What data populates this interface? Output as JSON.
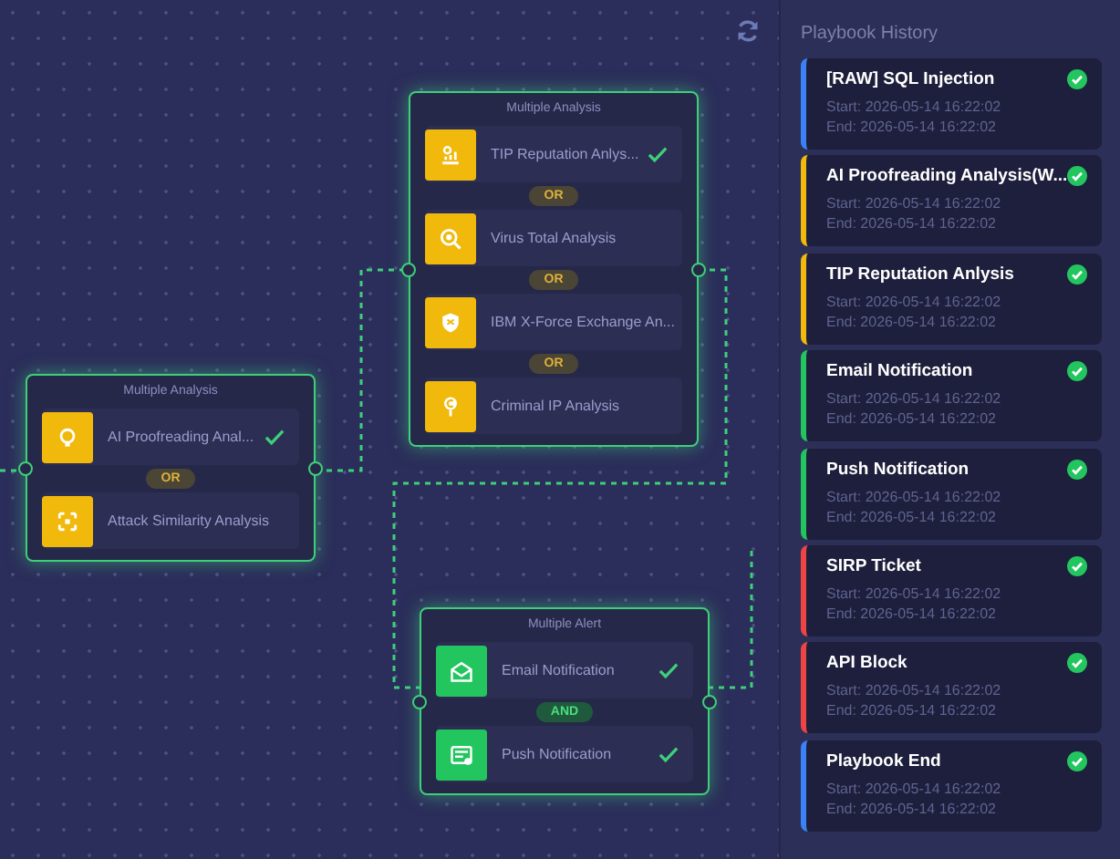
{
  "canvas": {
    "nodes": [
      {
        "title": "Multiple Analysis",
        "connectors": [
          "OR"
        ],
        "items": [
          {
            "label": "AI Proofreading Anal...",
            "done": true,
            "color": "#f0b90b"
          },
          {
            "label": "Attack Similarity Analysis",
            "done": false,
            "color": "#f0b90b"
          }
        ]
      },
      {
        "title": "Multiple Analysis",
        "connectors": [
          "OR",
          "OR",
          "OR"
        ],
        "items": [
          {
            "label": "TIP Reputation Anlys...",
            "done": true,
            "color": "#f0b90b"
          },
          {
            "label": "Virus Total Analysis",
            "done": false,
            "color": "#f0b90b"
          },
          {
            "label": "IBM X-Force Exchange An...",
            "done": false,
            "color": "#f0b90b"
          },
          {
            "label": "Criminal IP Analysis",
            "done": false,
            "color": "#f0b90b"
          }
        ]
      },
      {
        "title": "Multiple Alert",
        "connectors": [
          "AND"
        ],
        "items": [
          {
            "label": "Email Notification",
            "done": true,
            "color": "#22c55e"
          },
          {
            "label": "Push Notification",
            "done": true,
            "color": "#22c55e"
          }
        ]
      }
    ]
  },
  "history": {
    "title": "Playbook History",
    "items": [
      {
        "name": "[RAW] SQL Injection",
        "start": "Start: 2026-05-14 16:22:02",
        "end": "End: 2026-05-14 16:22:02",
        "color": "#3b82f6",
        "done": true
      },
      {
        "name": "AI Proofreading Analysis(W...",
        "start": "Start: 2026-05-14 16:22:02",
        "end": "End: 2026-05-14 16:22:02",
        "color": "#f0b90b",
        "done": true
      },
      {
        "name": "TIP Reputation Anlysis",
        "start": "Start: 2026-05-14 16:22:02",
        "end": "End: 2026-05-14 16:22:02",
        "color": "#f0b90b",
        "done": true
      },
      {
        "name": "Email Notification",
        "start": "Start: 2026-05-14 16:22:02",
        "end": "End: 2026-05-14 16:22:02",
        "color": "#22c55e",
        "done": true
      },
      {
        "name": "Push Notification",
        "start": "Start: 2026-05-14 16:22:02",
        "end": "End: 2026-05-14 16:22:02",
        "color": "#22c55e",
        "done": true
      },
      {
        "name": "SIRP Ticket",
        "start": "Start: 2026-05-14 16:22:02",
        "end": "End: 2026-05-14 16:22:02",
        "color": "#ef4444",
        "done": true
      },
      {
        "name": "API Block",
        "start": "Start: 2026-05-14 16:22:02",
        "end": "End: 2026-05-14 16:22:02",
        "color": "#ef4444",
        "done": true
      },
      {
        "name": "Playbook End",
        "start": "Start: 2026-05-14 16:22:02",
        "end": "End: 2026-05-14 16:22:02",
        "color": "#3b82f6",
        "done": true
      }
    ]
  }
}
